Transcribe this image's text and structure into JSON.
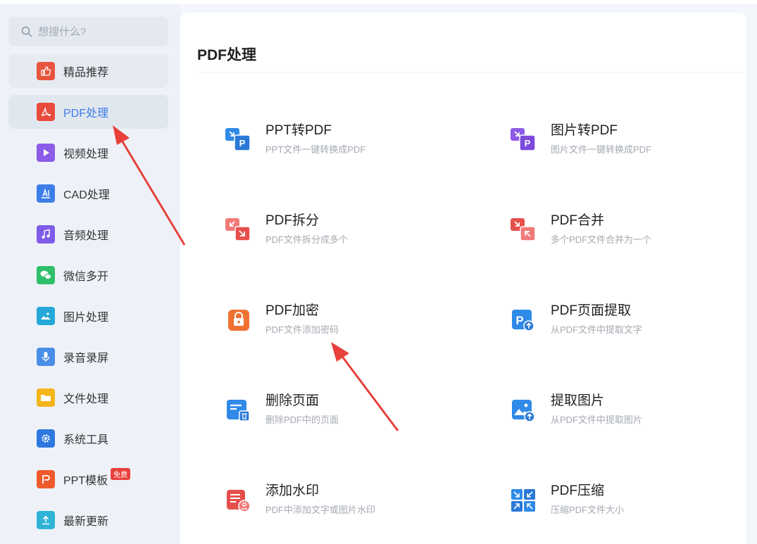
{
  "search": {
    "placeholder": "想搜什么?"
  },
  "sidebar": {
    "items": [
      {
        "label": "精品推荐",
        "icon": "thumbs-up-icon",
        "color": "#e8553e"
      },
      {
        "label": "PDF处理",
        "icon": "pdf-icon",
        "color": "#e84b3c",
        "active": true
      },
      {
        "label": "视频处理",
        "icon": "play-icon",
        "color": "#8a5ce8"
      },
      {
        "label": "CAD处理",
        "icon": "cad-icon",
        "color": "#3d7ee8"
      },
      {
        "label": "音频处理",
        "icon": "music-icon",
        "color": "#7e5ce8"
      },
      {
        "label": "微信多开",
        "icon": "wechat-icon",
        "color": "#2fbf6a"
      },
      {
        "label": "图片处理",
        "icon": "image-icon",
        "color": "#25a8d8"
      },
      {
        "label": "录音录屏",
        "icon": "microphone-icon",
        "color": "#4a8ee8"
      },
      {
        "label": "文件处理",
        "icon": "folder-icon",
        "color": "#f4b41a"
      },
      {
        "label": "系统工具",
        "icon": "gear-icon",
        "color": "#2f78e0"
      },
      {
        "label": "PPT模板",
        "icon": "ppt-icon",
        "color": "#ef5a2c",
        "badge": "免费"
      },
      {
        "label": "最新更新",
        "icon": "upload-icon",
        "color": "#2fb4d8"
      }
    ]
  },
  "main": {
    "title": "PDF处理",
    "tools": [
      {
        "name": "PPT转PDF",
        "desc": "PPT文件一键转换成PDF",
        "icon": "ppt-to-pdf-icon"
      },
      {
        "name": "图片转PDF",
        "desc": "图片文件一键转换成PDF",
        "icon": "image-to-pdf-icon"
      },
      {
        "name": "PDF拆分",
        "desc": "PDF文件拆分成多个",
        "icon": "pdf-split-icon"
      },
      {
        "name": "PDF合并",
        "desc": "多个PDF文件合并为一个",
        "icon": "pdf-merge-icon"
      },
      {
        "name": "PDF加密",
        "desc": "PDF文件添加密码",
        "icon": "lock-icon"
      },
      {
        "name": "PDF页面提取",
        "desc": "从PDF文件中提取文字",
        "icon": "page-extract-icon"
      },
      {
        "name": "删除页面",
        "desc": "删除PDF中的页面",
        "icon": "delete-page-icon"
      },
      {
        "name": "提取图片",
        "desc": "从PDF文件中提取图片",
        "icon": "extract-image-icon"
      },
      {
        "name": "添加水印",
        "desc": "PDF中添加文字或图片水印",
        "icon": "watermark-icon"
      },
      {
        "name": "PDF压缩",
        "desc": "压缩PDF文件大小",
        "icon": "compress-icon"
      }
    ]
  },
  "colors": {
    "accent": "#3d7ee8",
    "arrow": "#e8413c"
  }
}
